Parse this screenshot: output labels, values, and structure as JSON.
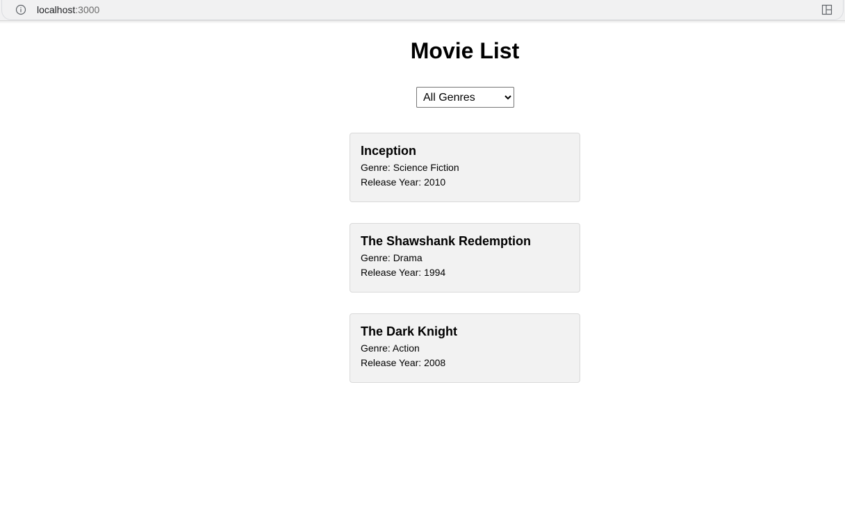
{
  "browser": {
    "url_host": "localhost",
    "url_port": ":3000"
  },
  "page": {
    "title": "Movie List"
  },
  "filter": {
    "selected": "All Genres"
  },
  "movies": [
    {
      "title": "Inception",
      "genre_line": "Genre: Science Fiction",
      "year_line": "Release Year: 2010"
    },
    {
      "title": "The Shawshank Redemption",
      "genre_line": "Genre: Drama",
      "year_line": "Release Year: 1994"
    },
    {
      "title": "The Dark Knight",
      "genre_line": "Genre: Action",
      "year_line": "Release Year: 2008"
    }
  ]
}
